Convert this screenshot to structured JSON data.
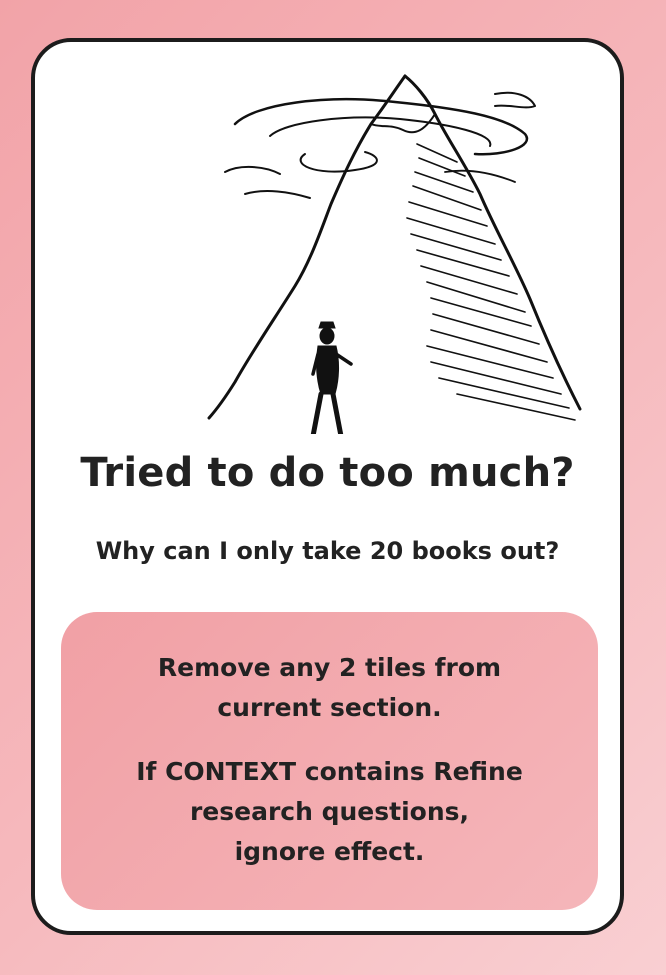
{
  "card": {
    "title": "Tried to do too much?",
    "subtitle": "Why can I only take 20 books out?",
    "effect_lines": [
      "Remove any 2 tiles from",
      "current section."
    ],
    "condition_lines": [
      "If CONTEXT contains Refine",
      "research questions,",
      "ignore effect."
    ],
    "illustration": "mountain-with-climber-illustration"
  },
  "colors": {
    "background": "#f4acb0",
    "card": "#ffffff",
    "border": "#1c1c1c",
    "effect_box": "#f3aaae",
    "text": "#222222"
  }
}
